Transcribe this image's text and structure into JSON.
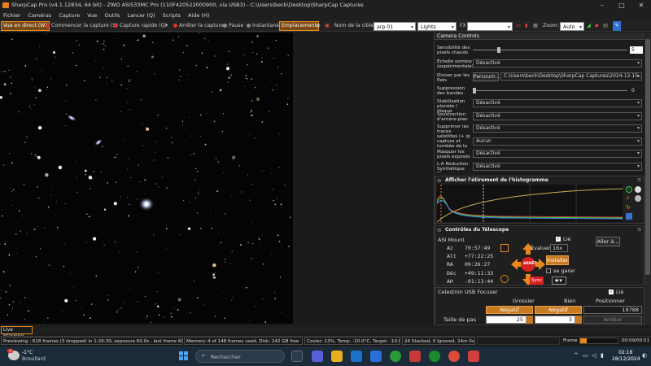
{
  "titlebar": {
    "title": "SharpCap Pro (v4.1.12834, 64 bit) - ZWO ASI533MC Pro (110F420522000900, via USB3) - C:\\Users\\beck\\Desktop\\SharpCap Captures"
  },
  "menu": [
    "Fichier",
    "Caméras",
    "Capture",
    "Vue",
    "Outils",
    "Lancer (Q)",
    "Scripts",
    "Aide (H)"
  ],
  "toolbar": {
    "live_view": "Vue en direct (W)",
    "start_capture": "Commencer la capture (S)",
    "quick_capture": "Capture rapide (Q)",
    "stop_capture": "Arrêter la capture",
    "pause": "Pause",
    "snapshot": "Instantané",
    "save": "Emplacement",
    "target_label": "Nom de la cible:",
    "target_value": "arp 01",
    "frame_type": "Lights",
    "fx_label": "FX",
    "fx_value": "",
    "zoom_label": "Zoom:",
    "zoom_value": "Auto"
  },
  "camera_controls": {
    "title": "Camera Controls",
    "rows": [
      {
        "label": "Sensibilité des pixels chauds",
        "type": "slider",
        "value": "5"
      },
      {
        "label": "Échelle sombre (expérimentale)",
        "type": "dropdown",
        "value": "Désactivé"
      },
      {
        "label": "Diviser par les flats",
        "type": "file",
        "button": "Parcourir...",
        "value": "C:\\Users\\beck\\Desktop\\SharpCap Captures\\2024-12-15..."
      },
      {
        "label": "Suppression des bandes",
        "type": "slider",
        "value": "0"
      },
      {
        "label": "Stabilisation planète / disque",
        "type": "dropdown",
        "value": "Désactivé"
      },
      {
        "label": "Soustraction d'arrière-plan",
        "type": "dropdown",
        "value": "Désactivé"
      },
      {
        "label": "Supprimer les traces satellites (+ ip capture et tombée de la nuit/ciel)",
        "type": "dropdown",
        "value": "Désactivé"
      },
      {
        "label": "",
        "type": "dropdown",
        "value": "Aucun"
      },
      {
        "label": "Masquer les pixels exposés",
        "type": "dropdown",
        "value": "Désactivé"
      },
      {
        "label": "L-A Réduction Synthétique Stars",
        "type": "dropdown",
        "value": "Désactivé"
      }
    ]
  },
  "histogram": {
    "title": "Afficher l'étirement de l'histogramme"
  },
  "telescope": {
    "title": "Contrôles du Télescope",
    "mount": "ASI Mount",
    "linked_label": "Lié",
    "evaluate_label": "Évaluer:",
    "rate_value": "16x",
    "goto_button": "Aller à...",
    "install_button": "Installer",
    "park_label": "se garer",
    "sync_button": "Sync",
    "stop_button": "ARRÊT",
    "coords": [
      {
        "k": "Az",
        "v": "70:57:49"
      },
      {
        "k": "Alt",
        "v": "+77:22:25"
      },
      {
        "k": "RA",
        "v": "09:26:27"
      },
      {
        "k": "Déc",
        "v": "+49:11:33"
      },
      {
        "k": "AH",
        "v": "-01:13:44"
      }
    ]
  },
  "focuser": {
    "title": "Celestron USB Focuser",
    "linked_label": "Lié",
    "col_coarse": "Grossier",
    "col_fine": "Bien",
    "col_position": "Positionner",
    "neg_coarse": "Négatif",
    "neg_fine": "Négatif",
    "position_value": "19788",
    "step_label": "Taille de pas",
    "step_coarse": "25",
    "step_fine": "3",
    "stop_button": "Arrêter"
  },
  "live_stacking_label": "Live Stacking",
  "status": {
    "previewing": "Previewing : 618 frames (3 dropped) in 1:26:30, exposure 60.0s , last frame 60.6s",
    "memory": "Memory: 4 of 148 frames used, Disk: 242 GB free",
    "cooler": "Cooler: 13%, Temp: -10.0°C, Target: -10.0°",
    "stacked": "24 Stacked, 0 Ignored, 24m 0s",
    "frame_label": "Frame:",
    "frame_time": "00:09/00:51",
    "frame_progress": 0.18
  },
  "taskbar": {
    "weather_temp": "-1°C",
    "weather_text": "Brouillard",
    "search_placeholder": "Rechercher",
    "time": "02:18",
    "date": "28/12/2024"
  },
  "colors": {
    "accent": "#e8891e",
    "panel": "#1c1c1c",
    "taskbar": "#1c2b3a"
  }
}
